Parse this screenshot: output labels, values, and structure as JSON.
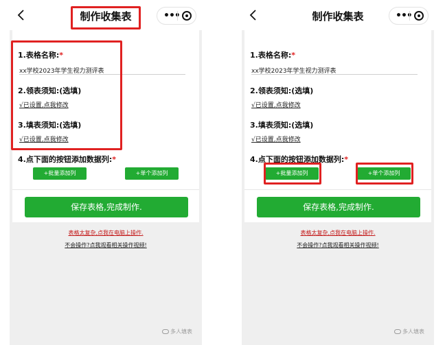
{
  "colors": {
    "accent_green": "#22ab33",
    "highlight_red": "#e02121",
    "required_red": "#e02020",
    "link_red": "#c41a1a"
  },
  "icons": {
    "back": "chevron-left-icon",
    "more": "more-dots-icon",
    "close": "target-close-icon",
    "checkmark": "checkmark-icon",
    "watermark": "wechat-logo-icon"
  },
  "screens": [
    {
      "navbar": {
        "title": "制作收集表"
      },
      "form": {
        "field1_label": "1.表格名称:",
        "required_mark": "*",
        "field1_value": "xx学校2023年学生视力测评表",
        "field2_label": "2.领表须知:(选填)",
        "field2_status": "√已设置,点我修改",
        "field3_label": "3.填表须知:(选填)",
        "field3_status": "√已设置,点我修改",
        "field4_label": "4.点下面的按钮添加数据列:",
        "batch_add_label": "+批量添加列",
        "single_add_label": "+单个添加列",
        "save_label": "保存表格,完成制作."
      },
      "links": {
        "complex_link": "表格太复杂,点我在电脑上操作.",
        "video_link": "不会操作?点我观看相关操作视频!"
      },
      "watermark": "多人填表"
    },
    {
      "navbar": {
        "title": "制作收集表"
      },
      "form": {
        "field1_label": "1.表格名称:",
        "required_mark": "*",
        "field1_value": "xx学校2023年学生视力测评表",
        "field2_label": "2.领表须知:(选填)",
        "field2_status": "√已设置,点我修改",
        "field3_label": "3.填表须知:(选填)",
        "field3_status": "√已设置,点我修改",
        "field4_label": "4.点下面的按钮添加数据列:",
        "batch_add_label": "+批量添加列",
        "single_add_label": "+单个添加列",
        "save_label": "保存表格,完成制作."
      },
      "links": {
        "complex_link": "表格太复杂,点我在电脑上操作.",
        "video_link": "不会操作?点我观看相关操作视频!"
      },
      "watermark": "多人填表"
    }
  ]
}
